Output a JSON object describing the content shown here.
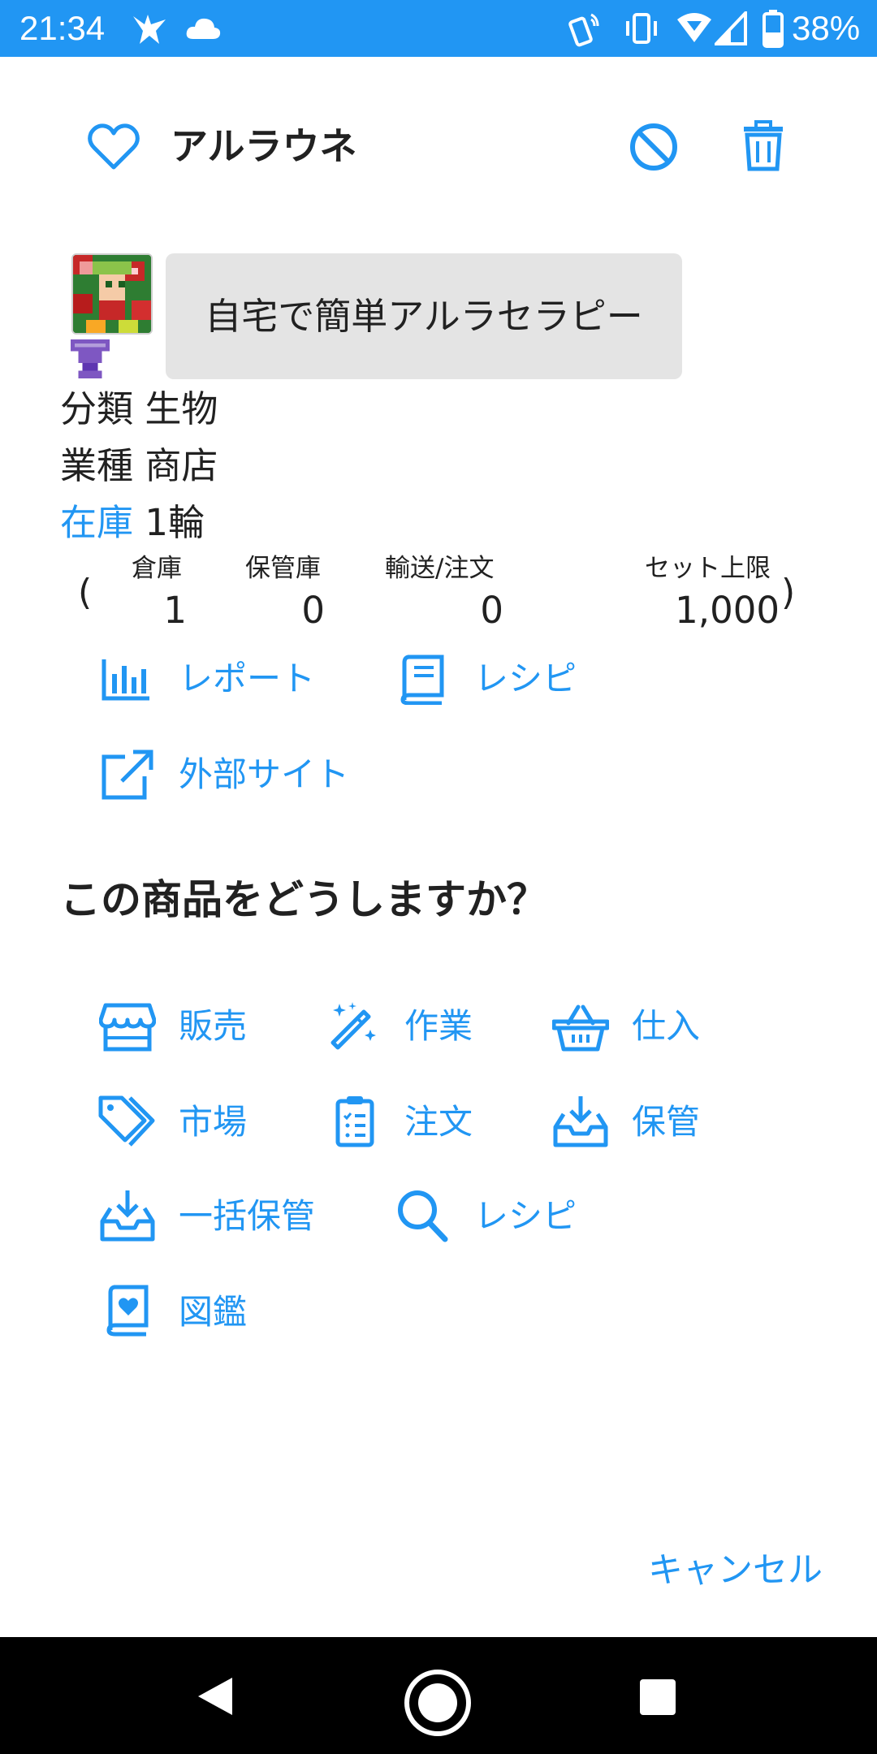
{
  "status_bar": {
    "time": "21:34",
    "battery": "38%"
  },
  "header": {
    "title": "アルラウネ",
    "favorite_icon": "heart-outline-icon",
    "block_icon": "block-icon",
    "delete_icon": "trash-icon"
  },
  "product": {
    "catchphrase": "自宅で簡単アルラセラピー",
    "category_label": "分類",
    "category_value": "生物",
    "industry_label": "業種",
    "industry_value": "商店",
    "stock_label": "在庫",
    "stock_value": "1輪"
  },
  "stock_table": {
    "open_paren": "(",
    "close_paren": ")",
    "headers": [
      "倉庫",
      "保管庫",
      "輸送/注文",
      "セット上限"
    ],
    "values": [
      "1",
      "0",
      "0",
      "1,000"
    ]
  },
  "links": [
    {
      "label": "レポート",
      "icon": "bar-chart-icon"
    },
    {
      "label": "レシピ",
      "icon": "book-icon"
    },
    {
      "label": "外部サイト",
      "icon": "external-link-icon"
    }
  ],
  "question": "この商品をどうしますか？",
  "actions": [
    {
      "label": "販売",
      "icon": "store-icon"
    },
    {
      "label": "作業",
      "icon": "magic-wand-icon"
    },
    {
      "label": "仕入",
      "icon": "basket-icon"
    },
    {
      "label": "市場",
      "icon": "tags-icon"
    },
    {
      "label": "注文",
      "icon": "clipboard-list-icon"
    },
    {
      "label": "保管",
      "icon": "inbox-download-icon"
    },
    {
      "label": "一括保管",
      "icon": "inbox-download-icon"
    },
    {
      "label": "レシピ",
      "icon": "search-icon"
    },
    {
      "label": "図鑑",
      "icon": "heart-book-icon"
    }
  ],
  "cancel_label": "キャンセル",
  "colors": {
    "accent": "#2196F3",
    "status_bar": "#2196F3",
    "catchphrase_bg": "#e4e4e4",
    "nav_bar": "#000000"
  }
}
